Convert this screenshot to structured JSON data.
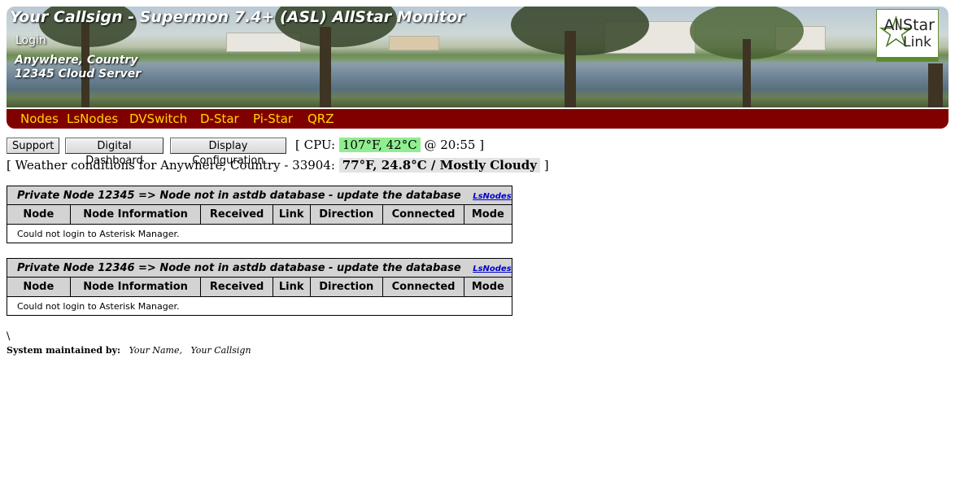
{
  "header": {
    "title": "Your Callsign - Supermon 7.4+ (ASL) AllStar Monitor",
    "login_label": "Login",
    "location_line1": "Anywhere, Country",
    "location_line2": "12345 Cloud Server",
    "logo_line1": "AllStar",
    "logo_line2": "Link"
  },
  "nav": {
    "items": [
      "Nodes",
      "LsNodes",
      "DVSwitch",
      "D-Star",
      "Pi-Star",
      "QRZ"
    ],
    "bg_color": "#800000",
    "text_color": "#ffd700"
  },
  "toolbar": {
    "support_label": "Support",
    "digital_dashboard_label": "Digital Dashboard",
    "display_config_label": "Display Configuration"
  },
  "status": {
    "cpu_prefix": "[ CPU:",
    "cpu_value": "107°F, 42°C",
    "cpu_time": "@ 20:55 ]",
    "weather_prefix": "[ Weather conditions for Anywhere, Country - 33904:",
    "weather_value": "77°F, 24.8°C / Mostly Cloudy",
    "weather_suffix": "]",
    "cpu_highlight_color": "#90ee90"
  },
  "node_tables": [
    {
      "title": "Private Node 12345 => Node not in astdb database - update the database",
      "link_label": "LsNodes",
      "columns": [
        "Node",
        "Node Information",
        "Received",
        "Link",
        "Direction",
        "Connected",
        "Mode"
      ],
      "message": "Could not login to Asterisk Manager."
    },
    {
      "title": "Private Node 12346 => Node not in astdb database - update the database",
      "link_label": "LsNodes",
      "columns": [
        "Node",
        "Node Information",
        "Received",
        "Link",
        "Direction",
        "Connected",
        "Mode"
      ],
      "message": "Could not login to Asterisk Manager."
    }
  ],
  "footer": {
    "backslash": "\\",
    "maintained_label": "System maintained by:",
    "name": "Your Name,",
    "callsign": "Your Callsign"
  }
}
